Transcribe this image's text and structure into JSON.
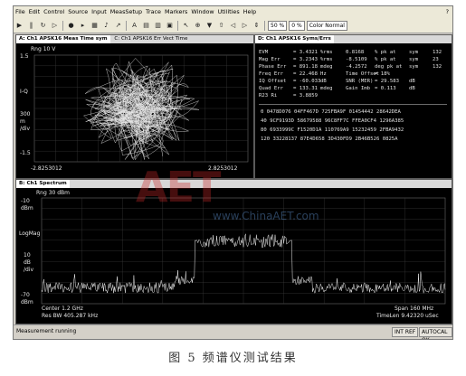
{
  "menu": [
    "File",
    "Edit",
    "Control",
    "Source",
    "Input",
    "MeasSetup",
    "Trace",
    "Markers",
    "Window",
    "Utilities",
    "Help"
  ],
  "menu_help_glyph": "?",
  "toolbar": {
    "zoom1": "50 %",
    "zoom2": "0 %",
    "color_mode": "Color Normal"
  },
  "pane_a": {
    "tab1": "A: Ch1 APSK16 Meas Time",
    "tab1_unit": "sym",
    "tab2": "C: Ch1 APSK16 Err Vect Time",
    "rng": "Rng 10 V",
    "y_top": "1.5",
    "y_mid1": "I-Q",
    "y_mid2": "300",
    "y_mid3": "m",
    "y_mid4": "/div",
    "y_bot": "-1.5",
    "x_left": "-2.8253012",
    "x_right": "2.8253012"
  },
  "pane_d": {
    "title": "D: Ch1 APSK16 Syms/Errs",
    "metrics": [
      {
        "name": "EVM",
        "val": "= 3.4321",
        "unit": "%rms",
        "val2": "0.8168",
        "unit2": "% pk at",
        "sym": "sym",
        "cnt": "132"
      },
      {
        "name": "Mag Err",
        "val": "= 3.2343",
        "unit": "%rms",
        "val2": "-8.5109",
        "unit2": "% pk at",
        "sym": "sym",
        "cnt": "23"
      },
      {
        "name": "Phase Err",
        "val": "= 891.18",
        "unit": "mdeg",
        "val2": "-4.2572",
        "unit2": "deg pk at",
        "sym": "sym",
        "cnt": "132"
      },
      {
        "name": "Freq Err",
        "val": "= 22.468",
        "unit": "Hz",
        "val2": "Time Offset",
        "unit2": "= 18%",
        "sym": "",
        "cnt": ""
      },
      {
        "name": "IQ Offset",
        "val": "= -60.033",
        "unit": "dB",
        "val2": "SNR (MER)",
        "unit2": "= 29.583",
        "sym": "dB",
        "cnt": ""
      },
      {
        "name": "Quad Err",
        "val": "= 133.31",
        "unit": "mdeg",
        "val2": "Gain Imb",
        "unit2": "= 0.113",
        "sym": "dB",
        "cnt": ""
      },
      {
        "name": "R23 Ri",
        "val": "= 3.8859",
        "unit": "",
        "val2": "",
        "unit2": "",
        "sym": "",
        "cnt": ""
      }
    ],
    "hex_rows": [
      "0 0478D076 04FF467D 725FBA9F 01454442 28642DEA",
      "40 9CF9193D 58679588 96C8FF7C FFEA0CF4 1296A385",
      "80 6933999C F1520D1A 110769A9 15232459 2FBA9432",
      "120 33228137 87E4D658 3D430FD9 2B46B526 0825A"
    ]
  },
  "pane_b": {
    "title": "B: Ch1 Spectrum",
    "rng": "Rng 30 dBm",
    "y_top1": "-10",
    "y_top2": "dBm",
    "y_logmag": "LogMag",
    "y_div1": "10",
    "y_div2": "dB",
    "y_div3": "/div",
    "y_bot1": "-70",
    "y_bot2": "dBm",
    "center": "Center 1.2 GHz",
    "rbw": "Res BW 405.287 kHz",
    "span": "Span 160 MHz",
    "timelen": "TimeLen 9.42320 uSec"
  },
  "status": {
    "message": "Measurement running",
    "int_ref": "INT REF",
    "autocal": "AUTOCAL OK"
  },
  "watermark": "AET",
  "watermark_url": "www.ChinaAET.com",
  "caption": "图 5   频谱仪测试结果"
}
